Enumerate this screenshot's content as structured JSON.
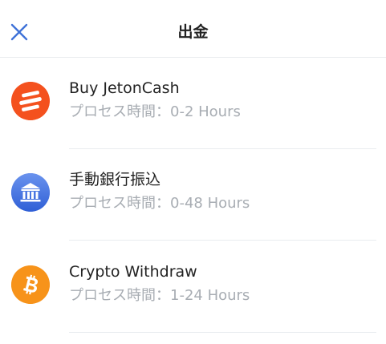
{
  "header": {
    "title": "出金",
    "close_icon": "close-icon"
  },
  "methods": [
    {
      "name": "Buy JetonCash",
      "time": "プロセス時間：0-2 Hours",
      "icon": "jetoncash-logo-icon",
      "color": "#f4511e"
    },
    {
      "name": "手動銀行振込",
      "time": "プロセス時間：0-48 Hours",
      "icon": "bank-icon",
      "color": "#3f6fe0"
    },
    {
      "name": "Crypto Withdraw",
      "time": "プロセス時間：1-24 Hours",
      "icon": "bitcoin-icon",
      "color": "#f7931a"
    }
  ]
}
